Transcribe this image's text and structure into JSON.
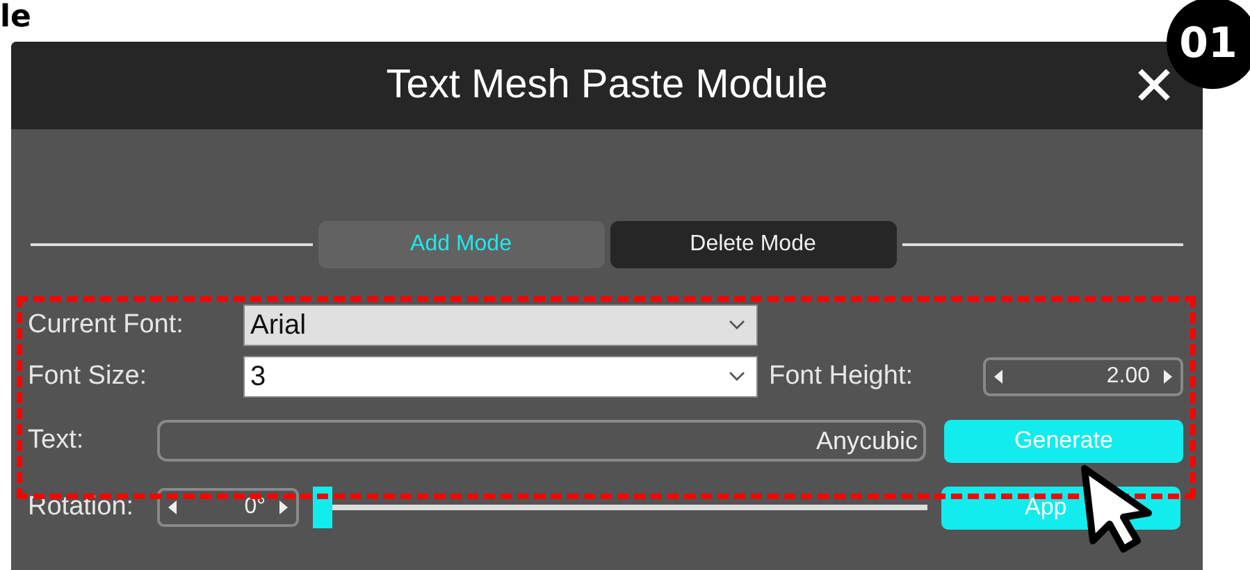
{
  "heading": "le",
  "badge": "01",
  "window": {
    "title": "Text Mesh Paste Module"
  },
  "tabs": [
    {
      "label": "Add Mode",
      "selected": true
    },
    {
      "label": "Delete Mode",
      "selected": false
    }
  ],
  "current_font": {
    "label": "Current Font:",
    "value": "Arial"
  },
  "font_size": {
    "label": "Font Size:",
    "value": "3"
  },
  "font_height": {
    "label": "Font Height:",
    "value": "2.00"
  },
  "text": {
    "label": "Text:",
    "value": "Anycubic"
  },
  "generate_button": "Generate",
  "rotation": {
    "label": "Rotation:",
    "value": "0°",
    "level": 0
  },
  "apply_button": "App"
}
